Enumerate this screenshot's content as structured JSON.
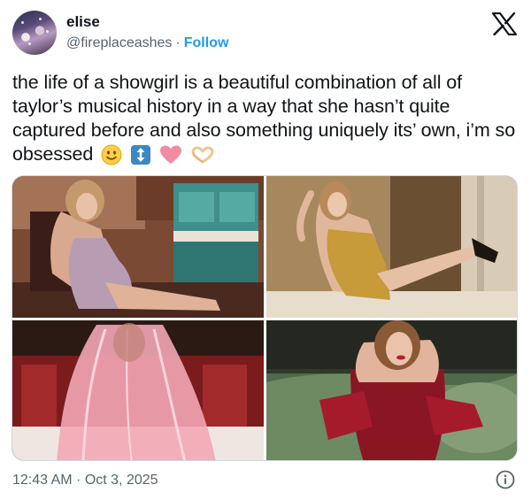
{
  "author": {
    "display_name": "elise",
    "handle": "@fireplaceashes",
    "separator": "·",
    "follow_label": "Follow"
  },
  "platform_icon": "x-logo-icon",
  "tweet": {
    "text": "the life of a showgirl is a beautiful combination of all of taylor’s musical history in a way that she hasn’t quite captured before and also something uniquely its’ own, i’m so obsessed",
    "emojis": [
      "slightly-smiling-face-icon",
      "up-down-arrow-icon",
      "pink-heart-icon",
      "heart-hands-icon"
    ]
  },
  "media": {
    "photos": [
      {
        "name": "photo-sequin-dress-by-piano",
        "scene": "woman in sparkling pink sequin dress seated by teal piano"
      },
      {
        "name": "photo-gold-dress-in-doorway",
        "scene": "woman in gold beaded dress with heels raised against doorway"
      },
      {
        "name": "photo-pink-sheer-cape",
        "scene": "sheer pink feathered cape in red room"
      },
      {
        "name": "photo-red-velvet-gloves",
        "scene": "woman in red corset and red opera gloves on green sofa"
      }
    ]
  },
  "footer": {
    "timestamp": "12:43 AM · Oct 3, 2025",
    "info_icon": "info-icon"
  },
  "colors": {
    "text": "#0f1419",
    "secondary": "#536471",
    "accent": "#1d9bf0",
    "border": "#cfd9de"
  }
}
